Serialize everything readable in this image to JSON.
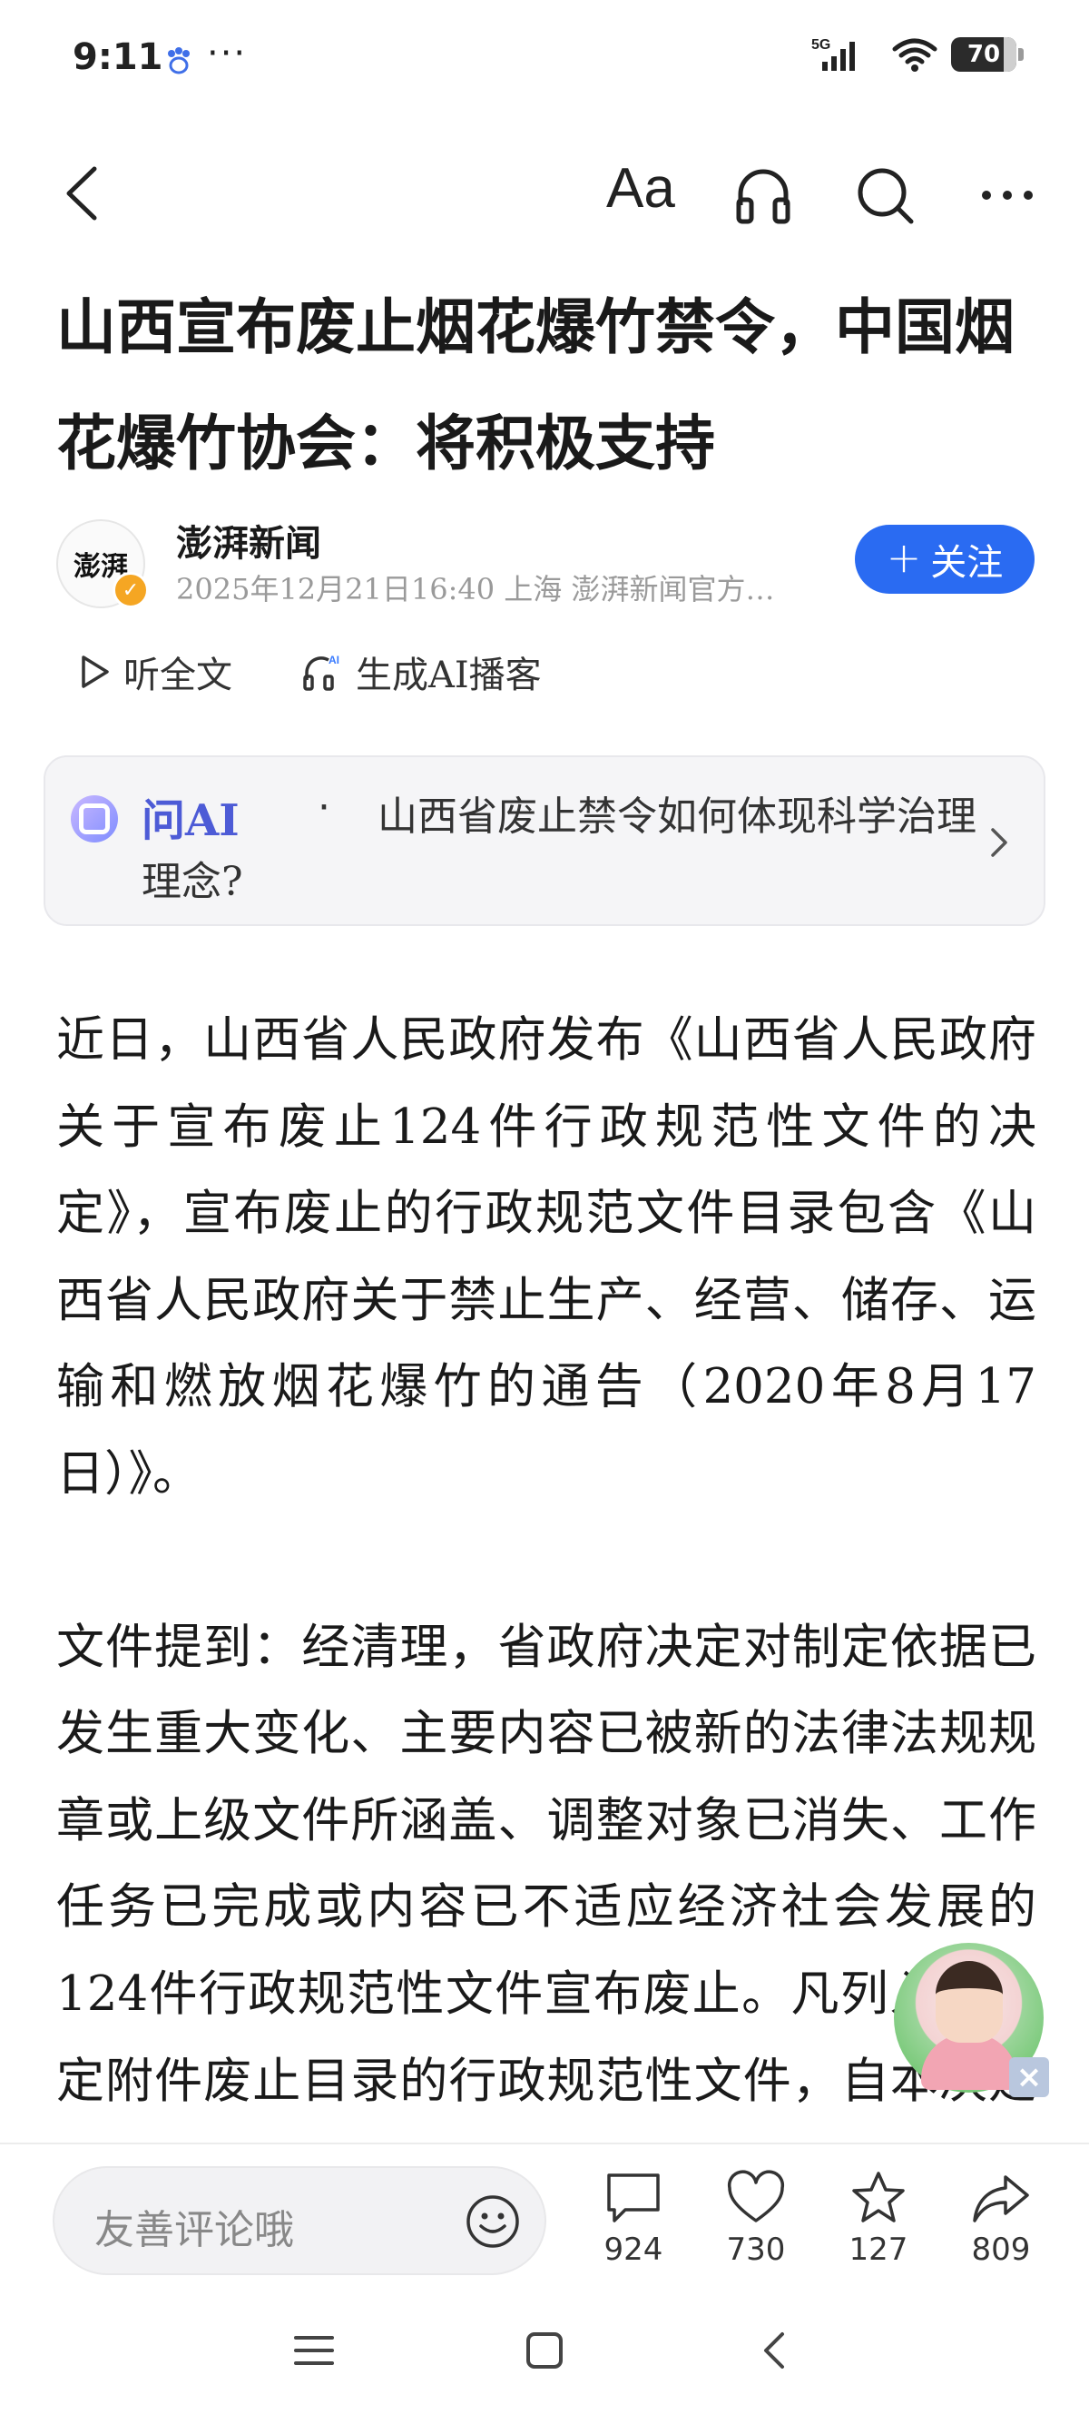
{
  "status_bar": {
    "time": "9:11",
    "more": "···",
    "network": "5G",
    "battery": "70"
  },
  "nav": {
    "font_size_label": "Aa"
  },
  "article": {
    "title": "山西宣布废止烟花爆竹禁令，中国烟花爆竹协会：将积极支持",
    "author": {
      "avatar_text": "澎湃",
      "name": "澎湃新闻",
      "meta": "2025年12月21日16:40  上海  澎湃新闻官方…",
      "follow_label": "关注"
    },
    "listen_label": "听全文",
    "podcast_label": "生成AI播客",
    "ask_ai": {
      "label": "问AI",
      "dot": "·",
      "question": "山西省废止禁令如何体现科学治理理念?"
    },
    "paragraphs": [
      "近日，山西省人民政府发布《山西省人民政府关于宣布废止124件行政规范性文件的决定》，宣布废止的行政规范文件目录包含《山西省人民政府关于禁止生产、经营、储存、运输和燃放烟花爆竹的通告（2020年8月17日）》。",
      "文件提到：经清理，省政府决定对制定依据已发生重大变化、主要内容已被新的法律法规规章或上级文件所涵盖、调整对象已消失、工作任务已完成或内容已不适应经济社会发展的124件行政规范性文件宣布废止。凡列入本决定附件废止目录的行政规范性文件，自本决定印发之日起停止"
    ]
  },
  "comment_bar": {
    "placeholder": "友善评论哦",
    "comments": "924",
    "likes": "730",
    "favorites": "127",
    "shares": "809"
  },
  "colors": {
    "accent": "#2a6bf2",
    "ai_purple": "#4d5bd6",
    "text": "#1a1a1a",
    "meta": "#9a9a9a"
  }
}
